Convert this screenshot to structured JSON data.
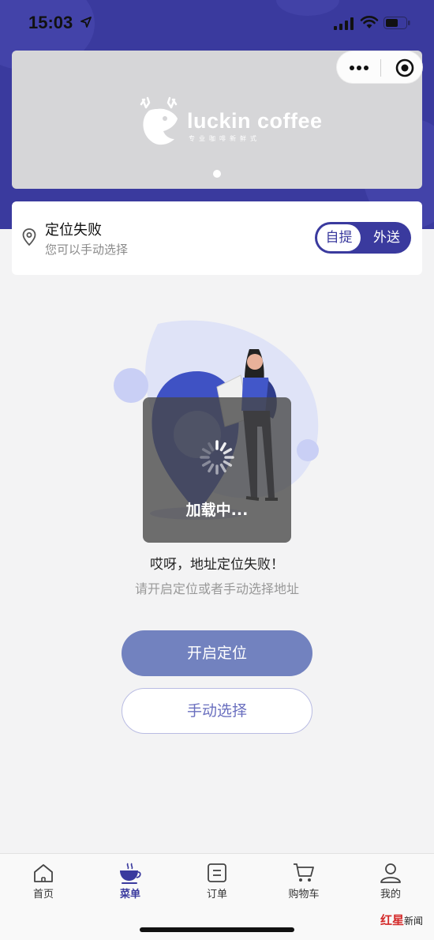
{
  "status_bar": {
    "time": "15:03"
  },
  "banner": {
    "brand": "luckin coffee",
    "slogan": "专业咖啡新鲜式"
  },
  "location": {
    "title": "定位失败",
    "subtitle": "您可以手动选择",
    "toggle": {
      "selected": "自提",
      "other": "外送"
    }
  },
  "loading": {
    "text": "加载中..."
  },
  "error": {
    "title": "哎呀，地址定位失败！",
    "subtitle": "请开启定位或者手动选择地址"
  },
  "buttons": {
    "enable_location": "开启定位",
    "manual_select": "手动选择"
  },
  "tabbar": {
    "items": [
      {
        "label": "首页",
        "icon": "home-icon"
      },
      {
        "label": "菜单",
        "icon": "coffee-cup-icon",
        "active": true
      },
      {
        "label": "订单",
        "icon": "order-icon"
      },
      {
        "label": "购物车",
        "icon": "cart-icon"
      },
      {
        "label": "我的",
        "icon": "user-icon"
      }
    ]
  },
  "watermark": {
    "brand": "红星",
    "suffix": "新闻"
  },
  "colors": {
    "brand": "#3a3a9e",
    "primary_button": "#7282bf",
    "background": "#f3f3f4"
  }
}
